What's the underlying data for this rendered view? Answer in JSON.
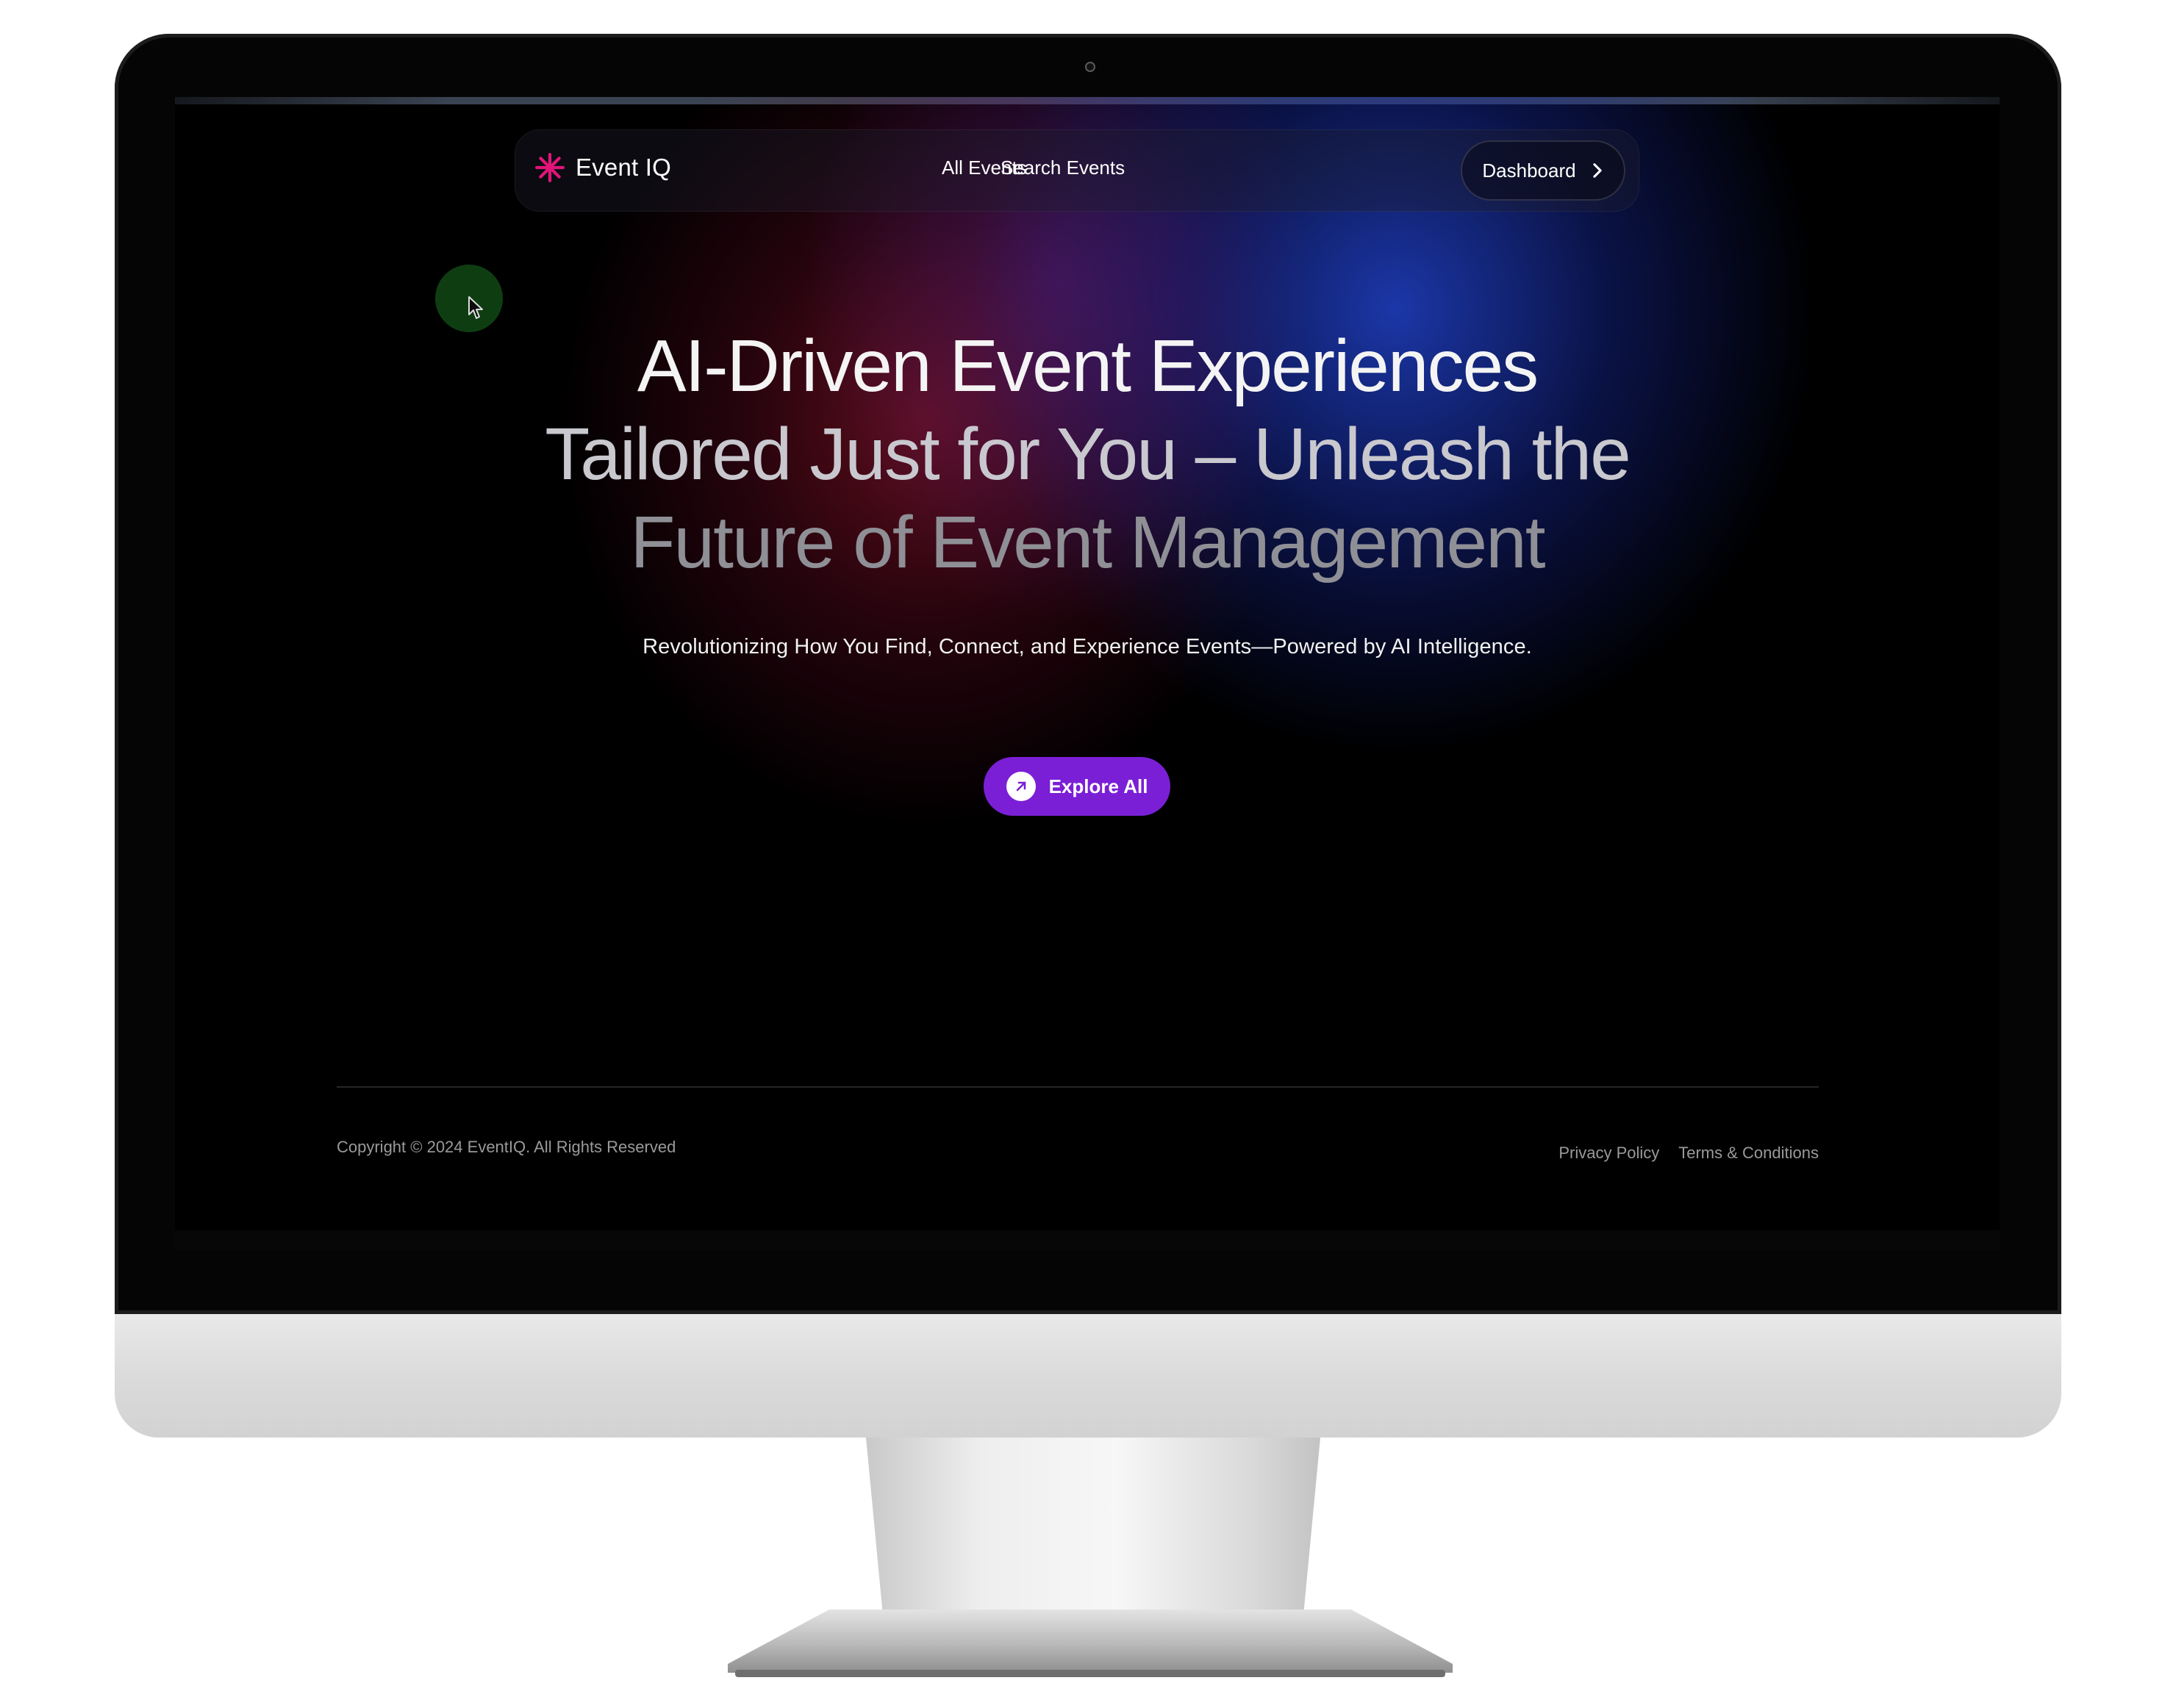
{
  "navbar": {
    "brand_name": "Event IQ",
    "brand_icon": "asterisk-icon",
    "links": [
      {
        "label": "All Events"
      },
      {
        "label": "Search Events"
      }
    ],
    "dashboard_label": "Dashboard"
  },
  "hero": {
    "title_lines": [
      "AI-Driven Event Experiences",
      "Tailored Just for You – Unleash the",
      "Future of Event Management"
    ],
    "subtitle": "Revolutionizing How You Find, Connect, and Experience Events—Powered by AI Intelligence.",
    "cta_label": "Explore All"
  },
  "footer": {
    "copyright": "Copyright © 2024 EventIQ. All Rights Reserved",
    "links": [
      {
        "label": "Privacy Policy"
      },
      {
        "label": "Terms & Conditions"
      }
    ]
  },
  "colors": {
    "brand_accent": "#e0157a",
    "cta_background": "#7b1fd6",
    "glow_red": "#96142a",
    "glow_blue": "#2346d7"
  }
}
